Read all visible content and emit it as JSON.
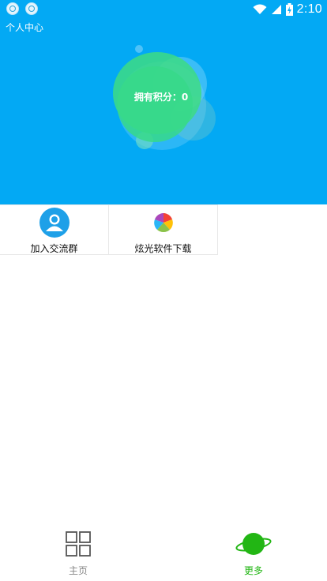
{
  "status_bar": {
    "time": "2:10",
    "icons": [
      "app-notification-icon",
      "app-notification-icon",
      "wifi-icon",
      "signal-icon",
      "battery-icon"
    ],
    "battery_charging": true
  },
  "header": {
    "title": "个人中心",
    "points_label": "拥有积分：0"
  },
  "grid": {
    "items": [
      {
        "label": "加入交流群",
        "icon": "group-chat-icon"
      },
      {
        "label": "炫光软件下载",
        "icon": "app-store-ball-icon"
      }
    ]
  },
  "bottom_nav": {
    "items": [
      {
        "label": "主页",
        "icon": "grid-home-icon",
        "active": false
      },
      {
        "label": "更多",
        "icon": "planet-icon",
        "active": true
      }
    ]
  },
  "colors": {
    "primary": "#03a9f4",
    "accent_green": "#22b614",
    "blob_green": "#3ddc84",
    "inactive": "#888888"
  }
}
